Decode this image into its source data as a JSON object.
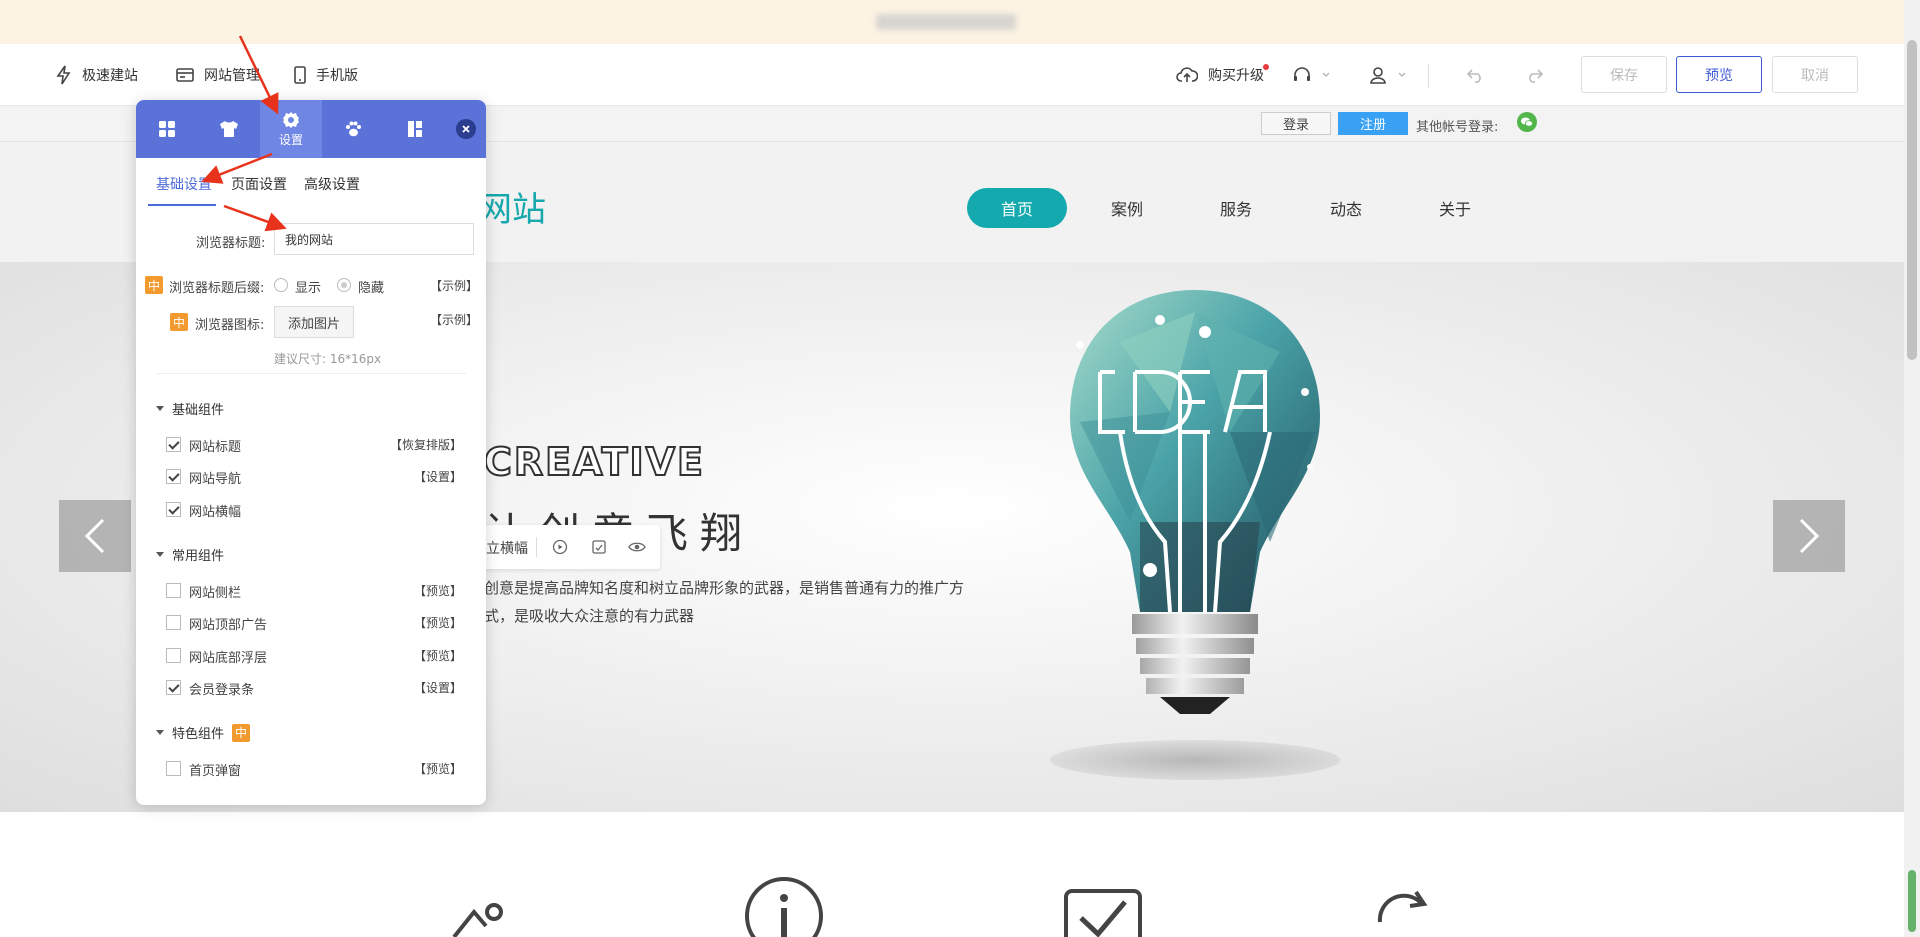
{
  "toolbar": {
    "quick_build": "极速建站",
    "site_manage": "网站管理",
    "mobile": "手机版",
    "buy_upgrade": "购买升级",
    "save": "保存",
    "preview": "预览",
    "cancel": "取消"
  },
  "member_bar": {
    "login": "登录",
    "register": "注册",
    "other_login": "其他帐号登录:"
  },
  "site": {
    "logo_text": "网站",
    "nav": [
      "首页",
      "案例",
      "服务",
      "动态",
      "关于"
    ],
    "banner_heading": "CREATIVE",
    "banner_slogan": "让创意飞翔",
    "banner_desc": "创意是提高品牌知名度和树立品牌形象的武器，是销售普通有力的推广方式，是吸收大众注意的有力武器",
    "banner_tool_label": "立横幅",
    "bulb_text": "IDEA"
  },
  "panel": {
    "active_tab_label": "设置",
    "subtabs": [
      "基础设置",
      "页面设置",
      "高级设置"
    ],
    "browser_title_label": "浏览器标题:",
    "browser_title_value": "我的网站",
    "suffix_label": "浏览器标题后缀:",
    "suffix_show": "显示",
    "suffix_hide": "隐藏",
    "example": "【示例】",
    "icon_label": "浏览器图标:",
    "add_image": "添加图片",
    "size_hint": "建议尺寸: 16*16px",
    "zh_tag": "中",
    "groups": {
      "basic": {
        "title": "基础组件",
        "items": [
          {
            "label": "网站标题",
            "checked": true,
            "action": "【恢复排版】"
          },
          {
            "label": "网站导航",
            "checked": true,
            "action": "【设置】"
          },
          {
            "label": "网站横幅",
            "checked": true,
            "action": ""
          }
        ]
      },
      "common": {
        "title": "常用组件",
        "items": [
          {
            "label": "网站侧栏",
            "checked": false,
            "action": "【预览】"
          },
          {
            "label": "网站顶部广告",
            "checked": false,
            "action": "【预览】"
          },
          {
            "label": "网站底部浮层",
            "checked": false,
            "action": "【预览】"
          },
          {
            "label": "会员登录条",
            "checked": true,
            "action": "【设置】"
          }
        ]
      },
      "special": {
        "title": "特色组件",
        "items": [
          {
            "label": "首页弹窗",
            "checked": false,
            "action": "【预览】"
          }
        ]
      }
    }
  },
  "colors": {
    "accent": "#5b73d8",
    "nav_active": "#13a9ae",
    "register": "#39a1f4",
    "tag": "#f29a2e",
    "arrow": "#e8331c"
  }
}
